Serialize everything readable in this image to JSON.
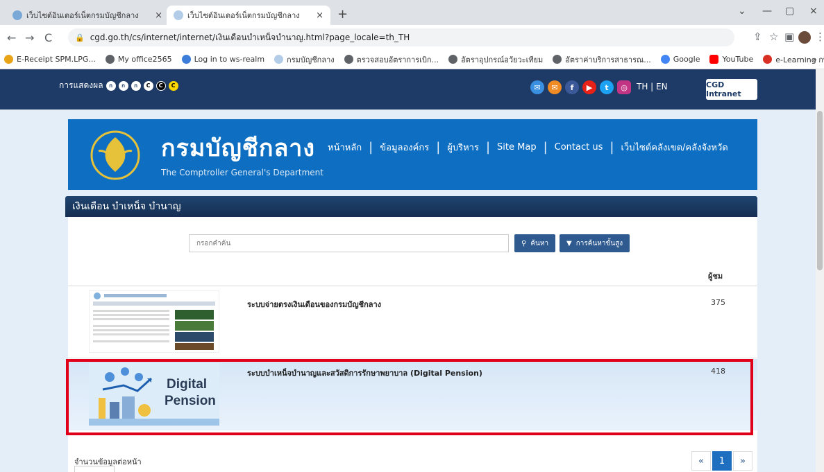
{
  "browser": {
    "tabs": [
      {
        "title": "เว็บไซต์อินเตอร์เน็ตกรมบัญชีกลาง",
        "close": "×"
      },
      {
        "title": "เว็บไซต์อินเตอร์เน็ตกรมบัญชีกลาง",
        "close": "×"
      }
    ],
    "new_tab": "+",
    "window_controls": {
      "minimize": "—",
      "restore": "▢",
      "close": "×",
      "menu": "⌄"
    },
    "nav": {
      "back": "←",
      "forward": "→",
      "reload": "C"
    },
    "url": "cgd.go.th/cs/internet/internet/เงินเดือนบำเหน็จบำนาญ.html?page_locale=th_TH",
    "bookmarks": [
      {
        "label": "E-Receipt SPM.LPG...",
        "color": "#e8a317"
      },
      {
        "label": "My office2565",
        "color": "#5f6368"
      },
      {
        "label": "Log in to ws-realm",
        "color": "#3b7dd8"
      },
      {
        "label": "กรมบัญชีกลาง",
        "color": "#b3cde8"
      },
      {
        "label": "ตรวจสอบอัตราการเบิก...",
        "color": "#5f6368"
      },
      {
        "label": "อัตราอุปกรณ์อวัยวะเทียม",
        "color": "#5f6368"
      },
      {
        "label": "อัตราค่าบริการสาธารณ...",
        "color": "#5f6368"
      },
      {
        "label": "Google",
        "color": "#4285f4"
      },
      {
        "label": "YouTube",
        "color": "#ff0000"
      },
      {
        "label": "e-Learning กพร",
        "color": "#d93025"
      }
    ],
    "bookmarks_more": "»"
  },
  "site": {
    "display_label": "การแสดงผล",
    "access_buttons": [
      "ก",
      "ก",
      "ก",
      "C",
      "C",
      "C"
    ],
    "socials": [
      {
        "icon": "mail-icon",
        "glyph": "✉",
        "color": "#3b8fe0"
      },
      {
        "icon": "envelope-orange-icon",
        "glyph": "✉",
        "color": "#f08a24"
      },
      {
        "icon": "facebook-icon",
        "glyph": "f",
        "color": "#3b5998"
      },
      {
        "icon": "youtube-icon",
        "glyph": "▶",
        "color": "#e62117"
      },
      {
        "icon": "twitter-icon",
        "glyph": "t",
        "color": "#1da1f2"
      },
      {
        "icon": "instagram-icon",
        "glyph": "◎",
        "color": "#c13584"
      }
    ],
    "lang": "TH | EN",
    "intranet": "CGD Intranet",
    "brand_th": "กรมบัญชีกลาง",
    "brand_en": "The Comptroller General's Department",
    "nav": [
      "หน้าหลัก",
      "ข้อมูลองค์กร",
      "ผู้บริหาร",
      "Site Map",
      "Contact us",
      "เว็บไซต์คลังเขต/คลังจังหวัด"
    ],
    "section_title": "เงินเดือน บำเหน็จ บำนาญ",
    "search_placeholder": "กรอกคำค้น",
    "search_button": "ค้นหา",
    "advanced_button": "การค้นหาขั้นสูง",
    "views_header": "ผู้ชม",
    "results": [
      {
        "title": "ระบบจ่ายตรงเงินเดือนของกรมบัญชีกลาง",
        "views": "375"
      },
      {
        "title": "ระบบบำเหน็จบำนาญและสวัสดิการรักษาพยาบาล (Digital Pension)",
        "views": "418",
        "thumb_line1": "Digital",
        "thumb_line2": "Pension"
      }
    ],
    "per_page_label": "จำนวนข้อมูลต่อหน้า",
    "pager": {
      "prev": "«",
      "current": "1",
      "next": "»"
    }
  }
}
